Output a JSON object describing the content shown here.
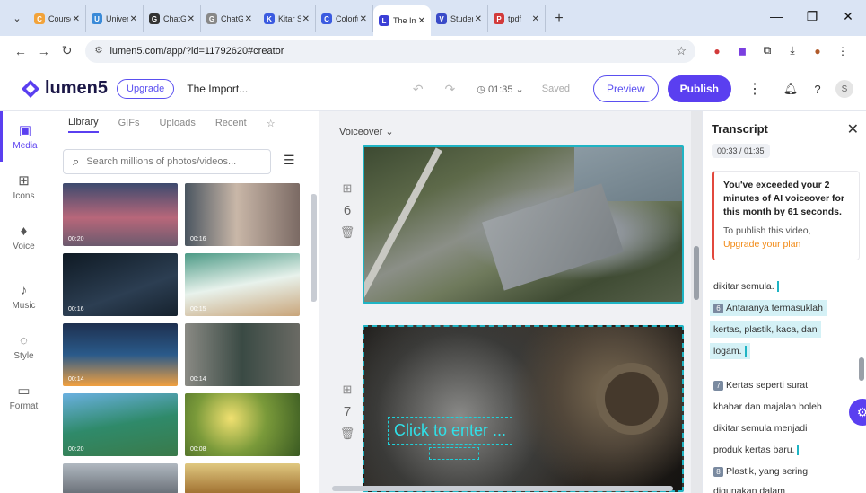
{
  "browser": {
    "tabs": [
      {
        "title": "Course",
        "color": "#f2a33a",
        "glyph": "C"
      },
      {
        "title": "Univers",
        "color": "#3a8ad8",
        "glyph": "U"
      },
      {
        "title": "ChatGF",
        "color": "#333333",
        "glyph": "G"
      },
      {
        "title": "ChatGF",
        "color": "#888888",
        "glyph": "G"
      },
      {
        "title": "Kitar Se",
        "color": "#3b5be0",
        "glyph": "K"
      },
      {
        "title": "Colorfu",
        "color": "#3b5be0",
        "glyph": "C"
      },
      {
        "title": "The Imp",
        "color": "#3b3fd6",
        "glyph": "L"
      },
      {
        "title": "Studen",
        "color": "#3a4bc8",
        "glyph": "V"
      },
      {
        "title": "tpdf",
        "color": "#d23a3a",
        "glyph": "P"
      }
    ],
    "new_tab": "+",
    "window_controls": [
      "—",
      "❐",
      "✕"
    ],
    "url": "lumen5.com/app/?id=11792620#creator"
  },
  "app": {
    "brand": "lumen5",
    "upgrade_label": "Upgrade",
    "project_title": "The Import...",
    "timer": "01:35",
    "saved_label": "Saved",
    "preview_label": "Preview",
    "publish_label": "Publish",
    "avatar_initial": "S",
    "accent": "#5a3ff0"
  },
  "rail": [
    {
      "label": "Media",
      "icon": "media-icon",
      "glyph": "▣"
    },
    {
      "label": "Icons",
      "icon": "icons-icon",
      "glyph": "⊞"
    },
    {
      "label": "Voice",
      "icon": "microphone-icon",
      "glyph": "♦"
    },
    {
      "label": "Music",
      "icon": "music-icon",
      "glyph": "♪"
    },
    {
      "label": "Style",
      "icon": "style-icon",
      "glyph": "◌"
    },
    {
      "label": "Format",
      "icon": "format-icon",
      "glyph": "▭"
    }
  ],
  "library": {
    "tabs": [
      "Library",
      "GIFs",
      "Uploads",
      "Recent"
    ],
    "search_placeholder": "Search millions of photos/videos...",
    "thumbs": [
      {
        "dur": "00:20",
        "bg": "linear-gradient(180deg,#3c4a6e,#b8677a 55%,#6b5a6e)"
      },
      {
        "dur": "00:16",
        "bg": "linear-gradient(90deg,#4a5560,#c9b7a8 45%,#7b6a64)"
      },
      {
        "dur": "00:16",
        "bg": "linear-gradient(160deg,#0f1a24,#2c3e52 60%,#16222e)"
      },
      {
        "dur": "00:15",
        "bg": "linear-gradient(170deg,#4c9a86,#e8f2ec 50%,#c9a57a)"
      },
      {
        "dur": "00:14",
        "bg": "linear-gradient(180deg,#1e3050,#2a5a8a 50%,#f0a040)"
      },
      {
        "dur": "00:14",
        "bg": "linear-gradient(90deg,#8a8a84,#3a4a44 50%,#6a6a64)"
      },
      {
        "dur": "00:20",
        "bg": "linear-gradient(170deg,#6ab0e0,#2f8a6a 50%,#3a7a4a)"
      },
      {
        "dur": "00:08",
        "bg": "radial-gradient(circle at 40% 40%,#f0e070,#7a9a3a 45%,#3a5a22)"
      },
      {
        "dur": "",
        "bg": "linear-gradient(180deg,#b0b8c0,#6a7078)"
      },
      {
        "dur": "",
        "bg": "linear-gradient(180deg,#e0c880,#a07030)"
      }
    ]
  },
  "canvas": {
    "voiceover_label": "Voiceover",
    "scenes": [
      {
        "number": "6"
      },
      {
        "number": "7",
        "placeholder": "Click to enter ..."
      }
    ]
  },
  "transcript": {
    "title": "Transcript",
    "time": "00:33 / 01:35",
    "warning_main": "You've exceeded your 2 minutes of AI voiceover for this month by 61 seconds.",
    "warning_pre": "To publish this video,",
    "warning_link": "Upgrade your plan",
    "lines": [
      {
        "text": "dikitar semula.",
        "hl": false,
        "cursor": true
      },
      {
        "text": "Antaranya termasuklah",
        "hl": true,
        "badge": "6"
      },
      {
        "text": "kertas, plastik, kaca, dan",
        "hl": true
      },
      {
        "text": "logam.",
        "hl": true,
        "cursor": true
      },
      {
        "text": "Kertas seperti surat",
        "hl": false,
        "badge": "7"
      },
      {
        "text": "khabar dan majalah boleh",
        "hl": false
      },
      {
        "text": "dikitar semula menjadi",
        "hl": false
      },
      {
        "text": "produk kertas baru.",
        "hl": false,
        "cursor": true
      },
      {
        "text": "Plastik, yang sering",
        "hl": false,
        "badge": "8"
      },
      {
        "text": "digunakan dalam",
        "hl": false
      }
    ]
  }
}
